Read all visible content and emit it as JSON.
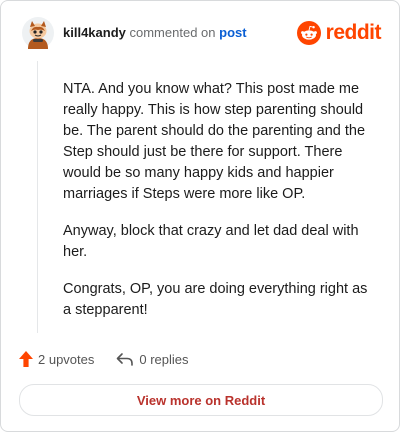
{
  "header": {
    "username": "kill4kandy",
    "action": "commented on",
    "post_link": "post",
    "brand": "reddit"
  },
  "comment": {
    "paragraphs": [
      "NTA. And you know what? This post made me really happy. This is how step parenting should be. The parent should do the parenting and the Step should just be there for support. There would be so many happy kids and happier marriages if Steps were more like OP.",
      "Anyway, block that crazy and let dad deal with her.",
      "Congrats, OP, you are doing everything right as a stepparent!"
    ]
  },
  "footer": {
    "upvotes": "2 upvotes",
    "replies": "0 replies"
  },
  "cta": {
    "label": "View more on Reddit"
  },
  "colors": {
    "brand": "#ff4500",
    "link": "#0a5fd4",
    "cta_text": "#b9322c"
  },
  "icons": {
    "avatar": "snoo-avatar-icon",
    "brand": "reddit-logo-icon",
    "upvote": "upvote-arrow-icon",
    "reply": "reply-arrow-icon"
  }
}
